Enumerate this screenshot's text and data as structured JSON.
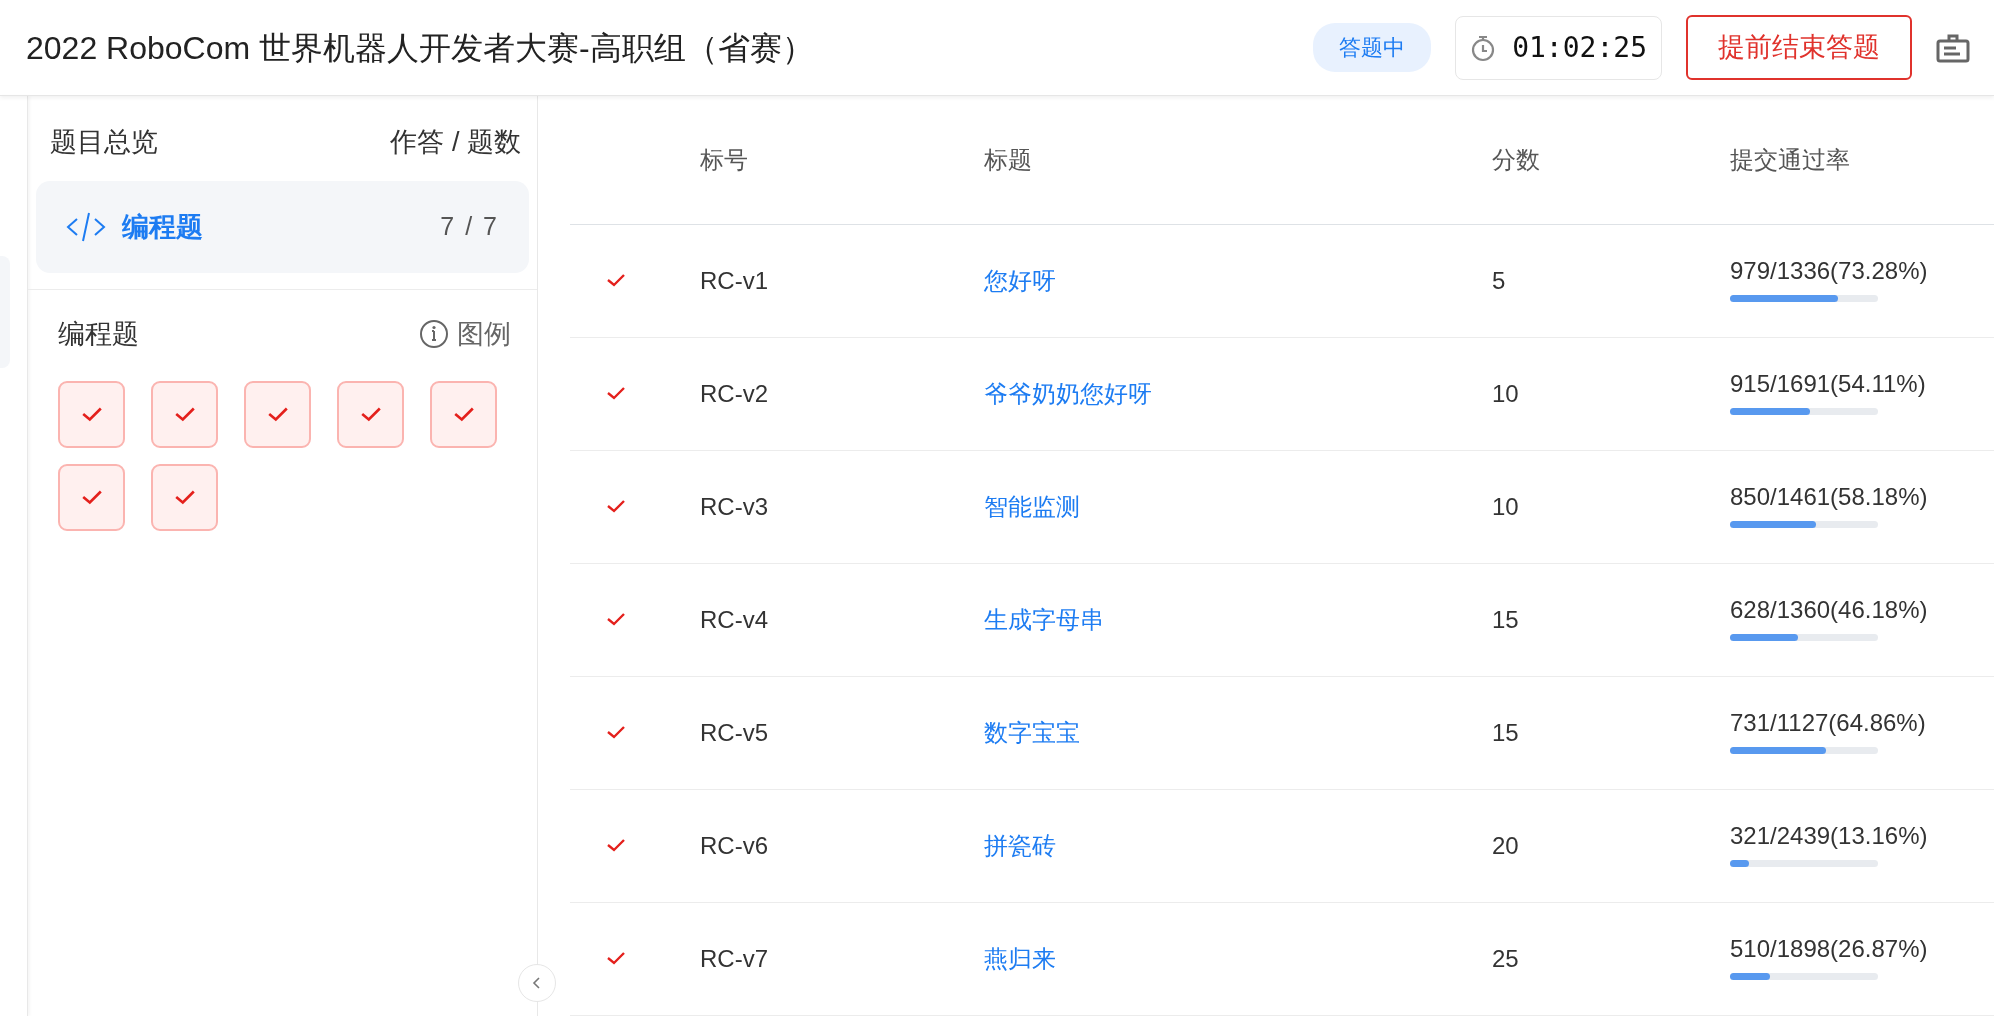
{
  "header": {
    "title": "2022 RoboCom 世界机器人开发者大赛-高职组（省赛）",
    "status": "答题中",
    "timer": "01:02:25",
    "end_button": "提前结束答题"
  },
  "overview": {
    "title": "题目总览",
    "count_label": "作答 / 题数",
    "categories": [
      {
        "label": "编程题",
        "count": "7 / 7",
        "selected": true
      }
    ]
  },
  "section": {
    "title": "编程题",
    "legend": "图例",
    "items": [
      {
        "solved": true
      },
      {
        "solved": true
      },
      {
        "solved": true
      },
      {
        "solved": true
      },
      {
        "solved": true
      },
      {
        "solved": true
      },
      {
        "solved": true
      }
    ]
  },
  "table": {
    "columns": [
      "标号",
      "标题",
      "分数",
      "提交通过率"
    ],
    "rows": [
      {
        "solved": true,
        "id": "RC-v1",
        "title": "您好呀",
        "score": "5",
        "rate": "979/1336(73.28%)",
        "level": 0.7328
      },
      {
        "solved": true,
        "id": "RC-v2",
        "title": "爷爷奶奶您好呀",
        "score": "10",
        "rate": "915/1691(54.11%)",
        "level": 0.5411
      },
      {
        "solved": true,
        "id": "RC-v3",
        "title": "智能监测",
        "score": "10",
        "rate": "850/1461(58.18%)",
        "level": 0.5818
      },
      {
        "solved": true,
        "id": "RC-v4",
        "title": "生成字母串",
        "score": "15",
        "rate": "628/1360(46.18%)",
        "level": 0.4618
      },
      {
        "solved": true,
        "id": "RC-v5",
        "title": "数字宝宝",
        "score": "15",
        "rate": "731/1127(64.86%)",
        "level": 0.6486
      },
      {
        "solved": true,
        "id": "RC-v6",
        "title": "拼瓷砖",
        "score": "20",
        "rate": "321/2439(13.16%)",
        "level": 0.1316
      },
      {
        "solved": true,
        "id": "RC-v7",
        "title": "燕归来",
        "score": "25",
        "rate": "510/1898(26.87%)",
        "level": 0.2687
      }
    ]
  }
}
